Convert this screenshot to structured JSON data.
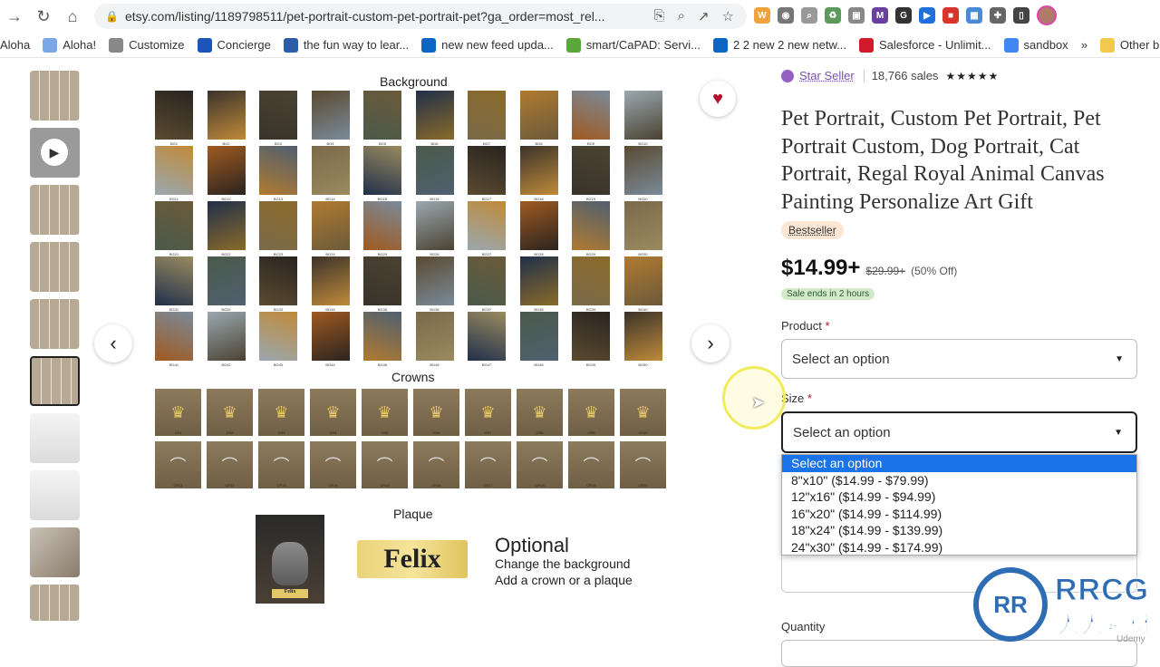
{
  "browser": {
    "url": "etsy.com/listing/1189798511/pet-portrait-custom-pet-portrait-pet?ga_order=most_rel...",
    "bookmarks": [
      {
        "label": "Aloha",
        "icon": "none",
        "color": "#ffffff"
      },
      {
        "label": "Aloha!",
        "icon": "cloud-icon",
        "color": "#7aa7e6"
      },
      {
        "label": "Customize",
        "icon": "customize-icon",
        "color": "#888888"
      },
      {
        "label": "Concierge",
        "icon": "concierge-icon",
        "color": "#1a56b8"
      },
      {
        "label": "the fun way to lear...",
        "icon": "learn-icon",
        "color": "#2b5ea7"
      },
      {
        "label": "new new feed upda...",
        "icon": "linkedin-icon",
        "color": "#0a66c2"
      },
      {
        "label": "smart/CaPAD: Servi...",
        "icon": "leaf-icon",
        "color": "#5aa83a"
      },
      {
        "label": "2 2 new 2 new netw...",
        "icon": "linkedin-icon",
        "color": "#0a66c2"
      },
      {
        "label": "Salesforce - Unlimit...",
        "icon": "salesforce-icon",
        "color": "#d11a2a"
      },
      {
        "label": "sandbox",
        "icon": "google-icon",
        "color": "#4285f4"
      },
      {
        "label": "»",
        "icon": "none",
        "color": "#ffffff"
      },
      {
        "label": "Other b",
        "icon": "folder-icon",
        "color": "#f2c94c"
      }
    ]
  },
  "gallery": {
    "background_title": "Background",
    "crowns_title": "Crowns",
    "plaque_title": "Plaque",
    "plaque_name": "Felix",
    "optional_title": "Optional",
    "optional_line1": "Change the background",
    "optional_line2": "Add a crown or a plaque",
    "bg_codes": [
      "BG1",
      "BG2",
      "BG3",
      "BG4",
      "BG5",
      "BG6",
      "BG7",
      "BG8",
      "BG9",
      "BG10",
      "BG11",
      "BG12",
      "BG13",
      "BG14",
      "BG15",
      "BG16",
      "BG17",
      "BG18",
      "BG19",
      "BG20",
      "BG21",
      "BG22",
      "BG23",
      "BG24",
      "BG25",
      "BG26",
      "BG27",
      "BG28",
      "BG29",
      "BG30",
      "BG31",
      "BG32",
      "BG33",
      "BG34",
      "BG35",
      "BG36",
      "BG37",
      "BG38",
      "BG39",
      "BG40",
      "BG41",
      "BG42",
      "BG43",
      "BG44",
      "BG45",
      "BG46",
      "BG47",
      "BG48",
      "BG49",
      "BG50"
    ],
    "crown_codes": [
      "CR1",
      "CR2",
      "CR3",
      "CR4",
      "CR5",
      "CR6",
      "CR7",
      "CR8",
      "CR9",
      "CR10",
      "CR11",
      "CR12",
      "CR13",
      "CR14",
      "CR15",
      "CR16",
      "CR17",
      "CR18",
      "CR19",
      "CR20"
    ]
  },
  "listing": {
    "star_seller": "Star Seller",
    "sales": "18,766 sales",
    "stars": "★★★★★",
    "title": "Pet Portrait, Custom Pet Portrait, Pet Portrait Custom, Dog Portrait, Cat Portrait, Regal Royal Animal Canvas Painting Personalize Art Gift",
    "bestseller": "Bestseller",
    "price": "$14.99+",
    "original_price": "$29.99+",
    "discount": "(50% Off)",
    "sale_badge": "Sale ends in 2 hours",
    "product_label": "Product",
    "product_value": "Select an option",
    "size_label": "Size",
    "size_value": "Select an option",
    "required_mark": "*",
    "quantity_label": "Quantity",
    "size_options": [
      "Select an option",
      "8\"x10\" ($14.99 - $79.99)",
      "12\"x16\" ($14.99 - $94.99)",
      "16\"x20\" ($14.99 - $114.99)",
      "18\"x24\" ($14.99 - $139.99)",
      "24\"x30\" ($14.99 - $174.99)"
    ]
  },
  "watermark": {
    "text": "RRCG",
    "sub": "人人素材",
    "udemy": "Udemy"
  }
}
